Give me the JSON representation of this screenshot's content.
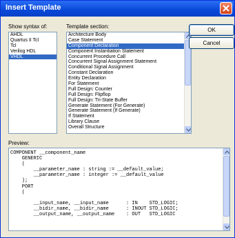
{
  "dialog": {
    "title": "Insert Template",
    "ok_label": "OK",
    "cancel_label": "Cancel"
  },
  "syntax": {
    "label": "Show syntax of:",
    "items": [
      "AHDL",
      "Quartus II Tcl",
      "Tcl",
      "Verilog HDL",
      "VHDL"
    ],
    "selected": "VHDL"
  },
  "template": {
    "label": "Template section:",
    "items": [
      "Architecture Body",
      "Case Statement",
      "Component Declaration",
      "Component Instantiation Statement",
      "Concurrent Procedure Call",
      "Concurrent Signal Assignment Statement",
      "Conditional Signal Assignment",
      "Constant Declaration",
      "Entity Declaration",
      "For Statement",
      "Full Design: Counter",
      "Full Design: Flipflop",
      "Full Design: Tri-State Buffer",
      "Generate Statement (For Generate)",
      "Generate Statement (If Generate)",
      "If Statement",
      "Library Clause",
      "Overall Structure"
    ],
    "selected": "Component Declaration"
  },
  "preview": {
    "label": "Preview:",
    "lines": [
      "COMPONENT __component_name",
      "    GENERIC",
      "    (",
      "        __parameter_name : string := __default_value;",
      "        __parameter_name : integer := __default_value",
      "    );",
      "    PORT",
      "    (",
      "",
      "        __input_name, __input_name      : IN    STD_LOGIC;",
      "        __bidir_name, __bidir_name      : INOUT STD_LOGIC;",
      "        __output_name, __output_name    : OUT   STD_LOGIC"
    ]
  },
  "colors": {
    "selection": "#316ac5",
    "titlebar": "#0a48d8",
    "dialog_bg": "#ece9d8"
  },
  "icons": {
    "close": "close-icon",
    "scroll_up": "chevron-up-icon",
    "scroll_down": "chevron-down-icon"
  }
}
